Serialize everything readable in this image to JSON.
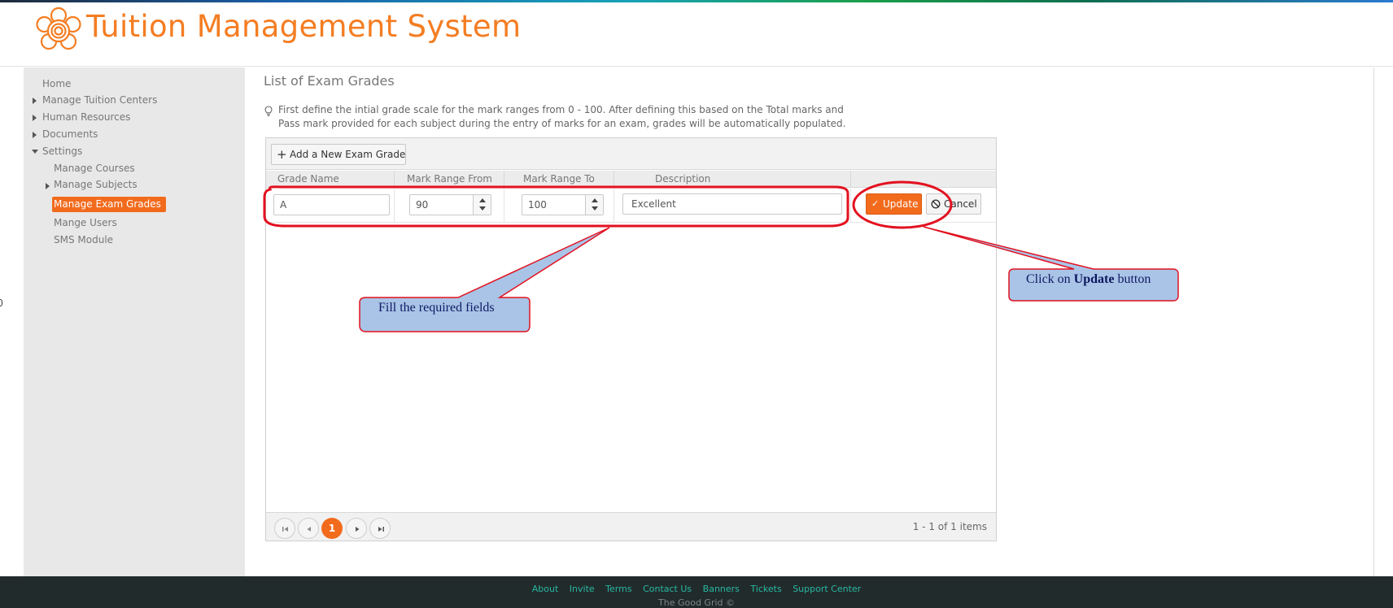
{
  "header": {
    "app_title": "Tuition Management System"
  },
  "sidebar": {
    "items": [
      {
        "label": "Home"
      },
      {
        "label": "Manage Tuition Centers"
      },
      {
        "label": "Human Resources"
      },
      {
        "label": "Documents"
      },
      {
        "label": "Settings"
      },
      {
        "label": "Manage Courses"
      },
      {
        "label": "Manage Subjects"
      },
      {
        "label": "Manage Exam Grades",
        "active": true
      },
      {
        "label": "Mange Users"
      },
      {
        "label": "SMS Module"
      }
    ]
  },
  "main": {
    "page_title": "List of Exam Grades",
    "hint_line1": "First define the intial grade scale for the mark ranges from 0 - 100. After defining this based on the Total marks and",
    "hint_line2": "Pass mark provided for each subject during the entry of marks for an exam, grades will be automatically populated."
  },
  "grid": {
    "toolbar": {
      "add_label": "Add a New Exam Grade"
    },
    "columns": [
      "Grade Name",
      "Mark Range From",
      "Mark Range To",
      "Description"
    ],
    "edit_row": {
      "grade_name": "A",
      "mark_from": "90",
      "mark_to": "100",
      "description": "Excellent",
      "update_label": "Update",
      "cancel_label": "Cancel"
    },
    "pager": {
      "current_page": "1",
      "info": "1 - 1 of 1 items"
    }
  },
  "footer": {
    "links": [
      "About",
      "Invite",
      "Terms",
      "Contact Us",
      "Banners",
      "Tickets",
      "Support Center"
    ],
    "copyright": "The Good Grid ©"
  },
  "annotations": {
    "fill_fields": "Fill the required fields",
    "click_prefix": "Click on",
    "click_bold": "Update",
    "click_suffix": "button"
  },
  "colors": {
    "accent": "#f26b1d",
    "title": "#f47d22",
    "callout_fill": "#a9c4e6",
    "callout_border": "#e3101f",
    "footer_bg": "#222b2b",
    "footer_link": "#27b8a3"
  }
}
